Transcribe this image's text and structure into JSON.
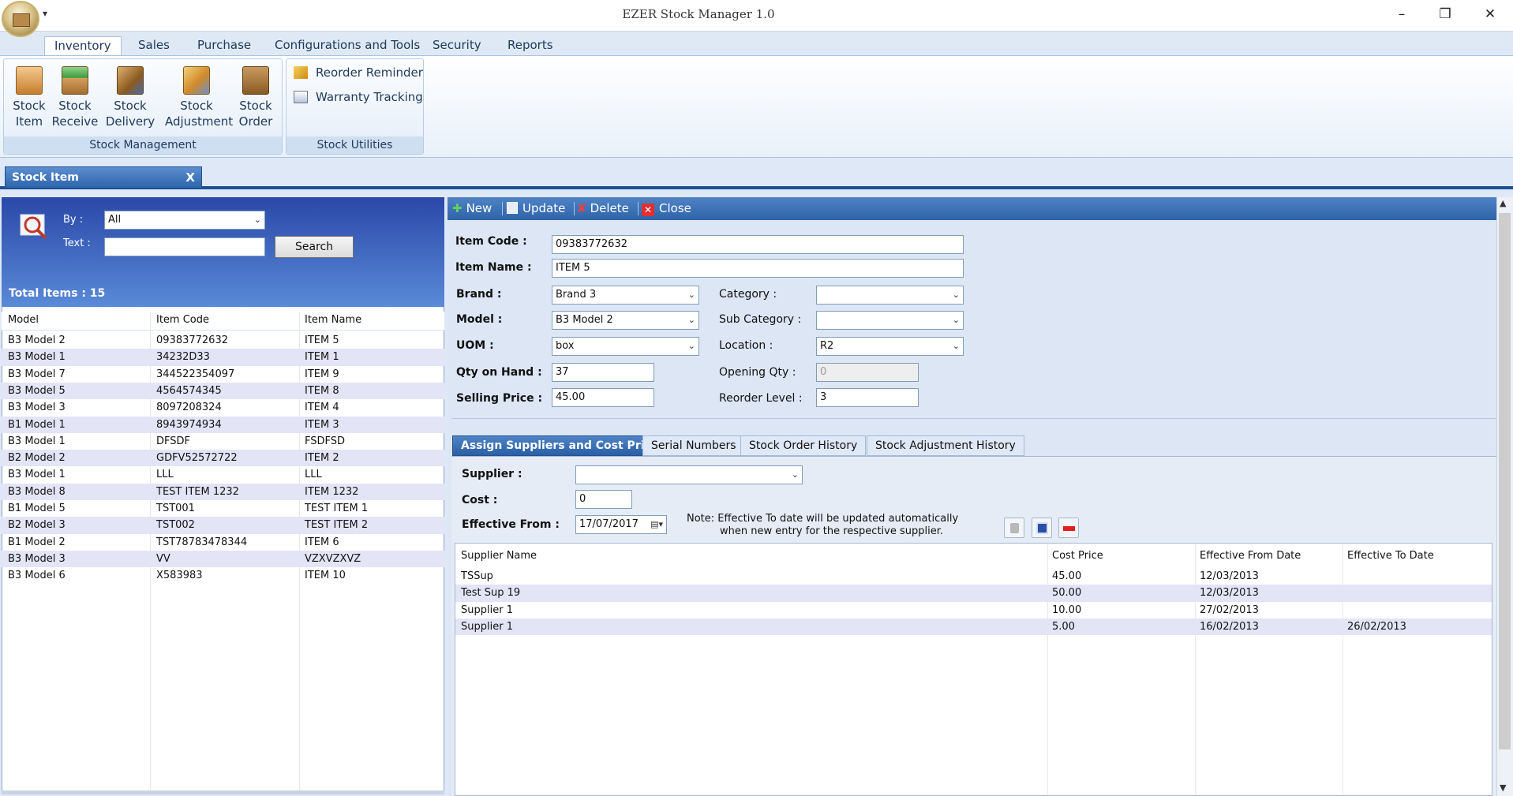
{
  "window": {
    "title": "EZER Stock Manager 1.0",
    "qat": "▾"
  },
  "ribbon": {
    "tabs": [
      "Inventory",
      "Sales",
      "Purchase",
      "Configurations and Tools",
      "Security",
      "Reports"
    ],
    "active_tab": "Inventory",
    "groups": {
      "stock_management": {
        "label": "Stock Management",
        "buttons": [
          {
            "line1": "Stock",
            "line2": "Item"
          },
          {
            "line1": "Stock",
            "line2": "Receive"
          },
          {
            "line1": "Stock",
            "line2": "Delivery"
          },
          {
            "line1": "Stock",
            "line2": "Adjustment"
          },
          {
            "line1": "Stock",
            "line2": "Order"
          }
        ]
      },
      "stock_utilities": {
        "label": "Stock Utilities",
        "buttons": [
          "Reorder Reminder",
          "Warranty Tracking"
        ]
      }
    }
  },
  "doc_tab": {
    "title": "Stock Item",
    "close": "X"
  },
  "search": {
    "by_label": "By :",
    "by_value": "All",
    "text_label": "Text :",
    "text_value": "",
    "button": "Search",
    "total_items": "Total Items : 15"
  },
  "item_list": {
    "columns": [
      "Model",
      "Item Code",
      "Item Name"
    ],
    "rows": [
      [
        "B3 Model 2",
        "09383772632",
        "ITEM 5"
      ],
      [
        "B3 Model 1",
        "34232D33",
        "ITEM 1"
      ],
      [
        "B3 Model 7",
        "344522354097",
        "ITEM 9"
      ],
      [
        "B3 Model 5",
        "4564574345",
        "ITEM 8"
      ],
      [
        "B3 Model 3",
        "8097208324",
        "ITEM 4"
      ],
      [
        "B1 Model 1",
        "8943974934",
        "ITEM 3"
      ],
      [
        "B3 Model 1",
        "DFSDF",
        "FSDFSD"
      ],
      [
        "B2 Model 2",
        "GDFV52572722",
        "ITEM 2"
      ],
      [
        "B3 Model 1",
        "LLL",
        "LLL"
      ],
      [
        "B3 Model 8",
        "TEST ITEM 1232",
        "ITEM 1232"
      ],
      [
        "B1 Model 5",
        "TST001",
        "TEST ITEM 1"
      ],
      [
        "B2 Model 3",
        "TST002",
        "TEST ITEM 2"
      ],
      [
        "B1 Model 2",
        "TST78783478344",
        "ITEM 6"
      ],
      [
        "B3 Model 3",
        "VV",
        "VZXVZXVZ"
      ],
      [
        "B3 Model 6",
        "X583983",
        "ITEM 10"
      ]
    ]
  },
  "toolbar": {
    "new": "New",
    "update": "Update",
    "delete": "Delete",
    "close": "Close"
  },
  "form": {
    "item_code_label": "Item Code :",
    "item_code": "09383772632",
    "item_name_label": "Item Name :",
    "item_name": "ITEM 5",
    "brand_label": "Brand :",
    "brand": "Brand 3",
    "model_label": "Model :",
    "model": "B3 Model 2",
    "uom_label": "UOM :",
    "uom": "box",
    "qty_label": "Qty on Hand :",
    "qty": "37",
    "price_label": "Selling Price :",
    "price": "45.00",
    "category_label": "Category :",
    "category": "",
    "subcategory_label": "Sub Category :",
    "subcategory": "",
    "location_label": "Location :",
    "location": "R2",
    "opening_label": "Opening Qty :",
    "opening": "0",
    "reorder_label": "Reorder Level :",
    "reorder": "3"
  },
  "subtabs": [
    "Assign Suppliers and Cost Price",
    "Serial Numbers",
    "Stock Order History",
    "Stock Adjustment History"
  ],
  "supplier_form": {
    "supplier_label": "Supplier :",
    "supplier": "",
    "cost_label": "Cost :",
    "cost": "0",
    "effective_label": "Effective From :",
    "effective": "17/07/2017",
    "note_line1": "Note: Effective To date will be updated automatically",
    "note_line2": "when new entry for the respective supplier."
  },
  "supplier_grid": {
    "columns": [
      "Supplier Name",
      "Cost Price",
      "Effective From Date",
      "Effective To Date"
    ],
    "rows": [
      [
        "TSSup",
        "45.00",
        "12/03/2013",
        ""
      ],
      [
        "Test Sup 19",
        "50.00",
        "12/03/2013",
        ""
      ],
      [
        "Supplier 1",
        "10.00",
        "27/02/2013",
        ""
      ],
      [
        "Supplier 1",
        "5.00",
        "16/02/2013",
        "26/02/2013"
      ]
    ]
  },
  "colors": {
    "accent": "#2f63a8",
    "ribbon_text": "#1e395b",
    "row_alt": "#e3e4f5"
  }
}
